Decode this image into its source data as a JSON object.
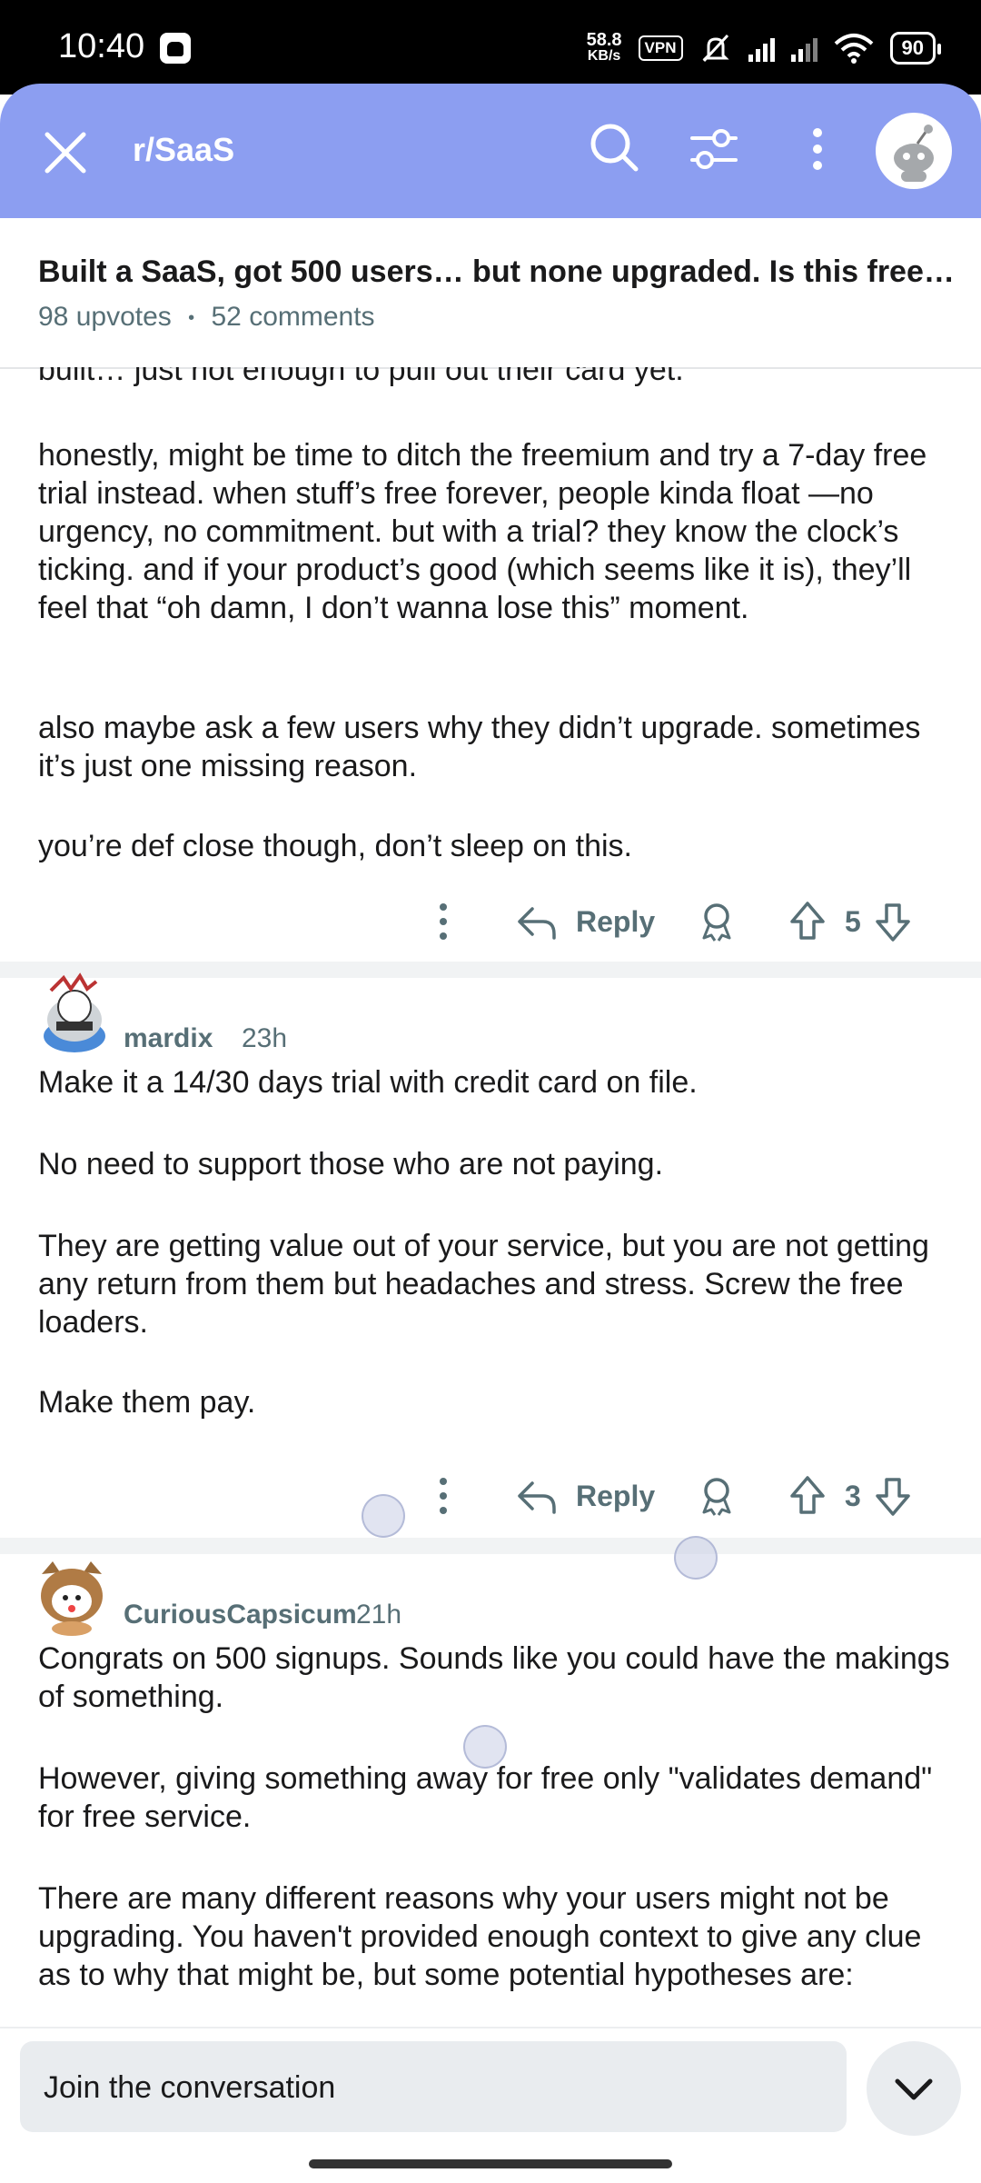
{
  "status_bar": {
    "time": "10:40",
    "net_speed_value": "58.8",
    "net_speed_unit": "KB/s",
    "vpn": "VPN",
    "battery": "90"
  },
  "header": {
    "subreddit": "r/SaaS"
  },
  "post": {
    "title": "Built a SaaS, got 500 users… but none upgraded. Is this free…",
    "upvotes": "98 upvotes",
    "separator": "•",
    "comments": "52 comments"
  },
  "comments": [
    {
      "truncated_top": "built… just not enough to pull out their card yet.",
      "paragraphs": [
        "honestly, might be time to ditch the freemium and try a 7-day free trial instead. when stuff’s free forever, people kinda float —no urgency, no commitment. but with a trial? they know the clock’s ticking. and if your product’s good (which seems like it is), they’ll feel that “oh damn, I don’t wanna lose this” moment.",
        "also maybe ask a few users why they didn’t upgrade. sometimes it’s just one missing reason.",
        "you’re def close though, don’t sleep on this."
      ],
      "reply_label": "Reply",
      "score": "5"
    },
    {
      "author": "mardix",
      "time": "23h",
      "paragraphs": [
        "Make it a 14/30 days trial with credit card on file.",
        "No need to support those who are not paying.",
        "They are getting value out of your service, but you are not getting any return from them but headaches and stress. Screw the free loaders.",
        "Make them pay."
      ],
      "reply_label": "Reply",
      "score": "3"
    },
    {
      "author": "CuriousCapsicum",
      "time": "21h",
      "paragraphs": [
        "Congrats on 500 signups. Sounds like you could have the makings of something.",
        "However, giving something away for free only \"validates demand\" for free service.",
        "There are many different reasons why your users might not be upgrading. You haven't provided enough context to give any clue as to why that might be, but some potential hypotheses are:"
      ]
    }
  ],
  "composer": {
    "placeholder": "Join the conversation"
  },
  "icons": {
    "close": "close-icon",
    "search": "search-icon",
    "filter": "filter-icon",
    "more": "more-vertical-icon",
    "avatar": "snoo-avatar-icon",
    "reply": "reply-icon",
    "award": "award-icon",
    "upvote": "upvote-icon",
    "downvote": "downvote-icon",
    "collapse": "chevron-down-icon"
  },
  "colors": {
    "header_bg": "#8c9ef1",
    "meta_text": "#576f76",
    "divider": "#f1f3f4"
  }
}
